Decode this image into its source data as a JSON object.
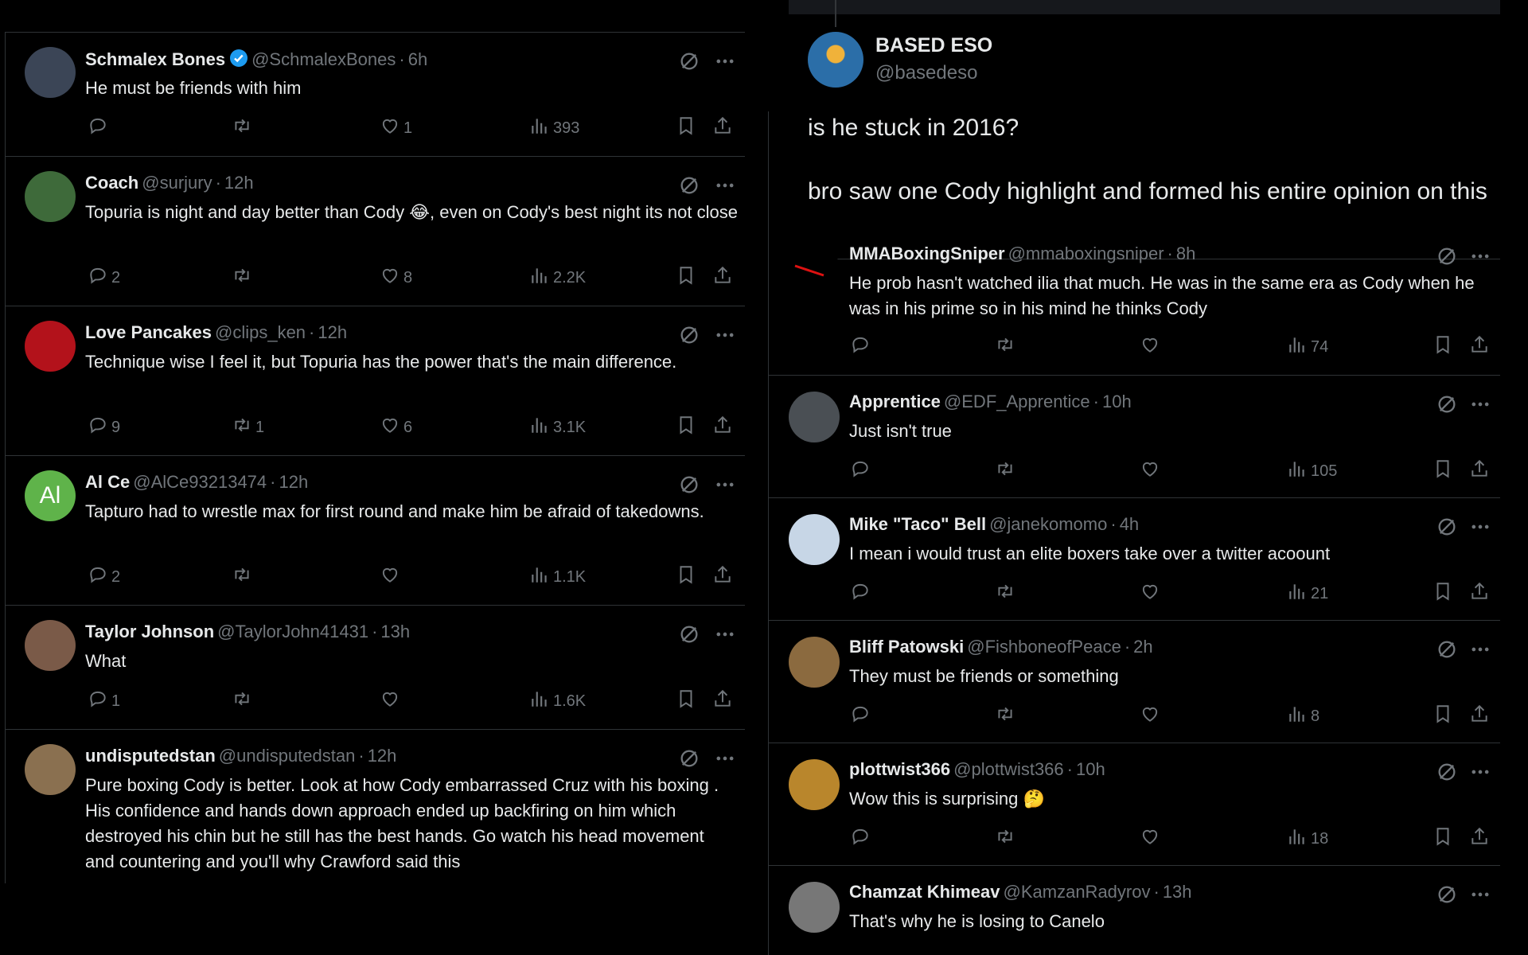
{
  "left": {
    "tweets": [
      {
        "name": "Schmalex Bones",
        "verified": true,
        "handle": "@SchmalexBones",
        "time": "6h",
        "text": "He must be friends with him",
        "emoji": "",
        "text_after": "",
        "replies": "",
        "retweets": "",
        "likes": "1",
        "views": "393",
        "avatar": "#3b4556"
      },
      {
        "name": "Coach",
        "verified": false,
        "handle": "@surjury",
        "time": "12h",
        "text": "Topuria is night and day better than Cody ",
        "emoji": "😂",
        "text_after": ", even on Cody's best night its not close",
        "replies": "2",
        "retweets": "",
        "likes": "8",
        "views": "2.2K",
        "avatar": "#3e6a3a"
      },
      {
        "name": "Love Pancakes",
        "verified": false,
        "handle": "@clips_ken",
        "time": "12h",
        "text": "Technique wise I feel it, but Topuria has the power that's the main difference.",
        "emoji": "",
        "text_after": "",
        "replies": "9",
        "retweets": "1",
        "likes": "6",
        "views": "3.1K",
        "avatar": "#b3121b"
      },
      {
        "name": "Al Ce",
        "verified": false,
        "handle": "@AlCe93213474",
        "time": "12h",
        "text": "Tapturo had to wrestle max for first round and make him be afraid of takedowns.",
        "emoji": "",
        "text_after": "",
        "replies": "2",
        "retweets": "",
        "likes": "",
        "views": "1.1K",
        "avatar": "#5fb34a",
        "initials": "Al"
      },
      {
        "name": "Taylor Johnson",
        "verified": false,
        "handle": "@TaylorJohn41431",
        "time": "13h",
        "text": "What",
        "emoji": "",
        "text_after": "",
        "replies": "1",
        "retweets": "",
        "likes": "",
        "views": "1.6K",
        "avatar": "#7a5a48"
      },
      {
        "name": "undisputedstan",
        "verified": false,
        "handle": "@undisputedstan",
        "time": "12h",
        "text": "Pure boxing Cody is better. Look at how Cody embarrassed Cruz with his boxing . His confidence and hands down approach ended up backfiring on him which destroyed his chin but he still has the best hands. Go watch his head movement and countering and you'll why Crawford said this",
        "emoji": "",
        "text_after": "",
        "replies": "",
        "retweets": "",
        "likes": "",
        "views": "",
        "avatar": "#8a7050"
      }
    ]
  },
  "right": {
    "main": {
      "name": "BASED ESO",
      "handle": "@basedeso",
      "line1": "is he stuck in 2016?",
      "line2": "bro saw one Cody highlight and formed his entire opinion on this"
    },
    "tweets": [
      {
        "name": "MMABoxingSniper",
        "handle": "@mmaboxingsniper",
        "time": "8h",
        "text": "He prob hasn't watched ilia that much. He was in the same era as Cody when he was in his prime so in his mind he thinks Cody",
        "emoji": "",
        "replies": "",
        "retweets": "",
        "likes": "",
        "views": "74",
        "avatar": "#000000"
      },
      {
        "name": "Apprentice",
        "handle": "@EDF_Apprentice",
        "time": "10h",
        "text": "Just isn't true",
        "emoji": "",
        "replies": "",
        "retweets": "",
        "likes": "",
        "views": "105",
        "avatar": "#4a4f54"
      },
      {
        "name": "Mike \"Taco\" Bell",
        "handle": "@janekomomo",
        "time": "4h",
        "text": "I mean i would trust an elite boxers take over a twitter acoount",
        "emoji": "",
        "replies": "",
        "retweets": "",
        "likes": "",
        "views": "21",
        "avatar": "#c7d6e6"
      },
      {
        "name": "Bliff Patowski",
        "handle": "@FishboneofPeace",
        "time": "2h",
        "text": "They must be friends or something",
        "emoji": "",
        "replies": "",
        "retweets": "",
        "likes": "",
        "views": "8",
        "avatar": "#8b6a3f"
      },
      {
        "name": "plottwist366",
        "handle": "@plottwist366",
        "time": "10h",
        "text": "Wow this is surprising ",
        "emoji": "🤔",
        "replies": "",
        "retweets": "",
        "likes": "",
        "views": "18",
        "avatar": "#b9862c"
      },
      {
        "name": "Chamzat Khimeav",
        "handle": "@KamzanRadyrov",
        "time": "13h",
        "text": "That's why he is losing to Canelo",
        "emoji": "",
        "replies": "",
        "retweets": "",
        "likes": "",
        "views": "",
        "avatar": "#777777"
      }
    ]
  }
}
